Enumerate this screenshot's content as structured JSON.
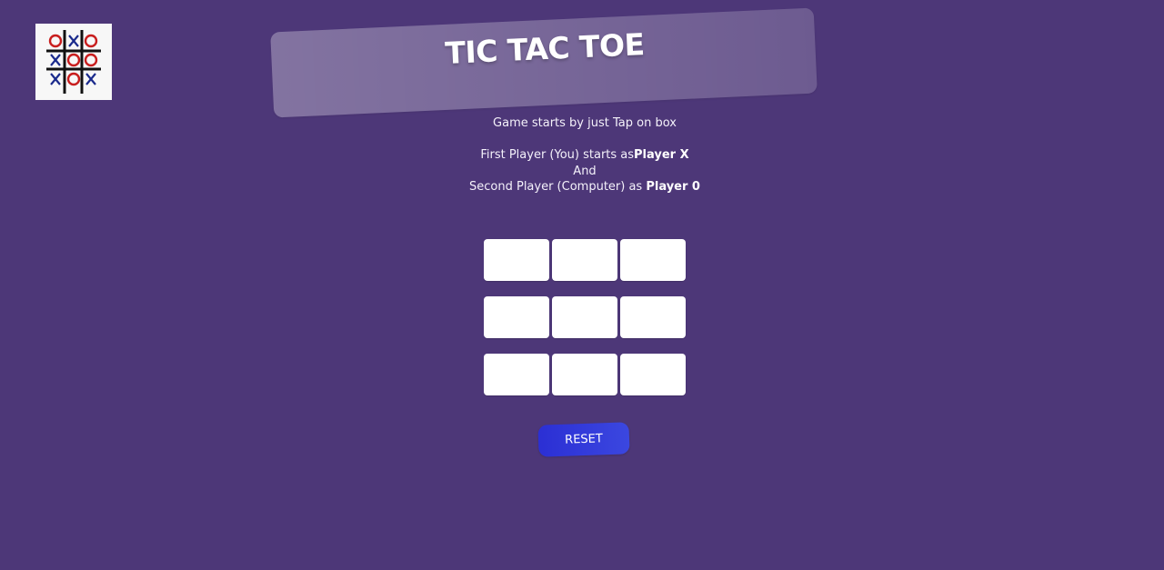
{
  "header": {
    "title": "TIC TAC TOE",
    "logo_icon": "tic-tac-toe-logo-icon",
    "logo_cells": [
      "O",
      "X",
      "O",
      "X",
      "O",
      "O",
      "X",
      "O",
      "X"
    ]
  },
  "instructions": {
    "line1": "Game starts by just Tap on box",
    "line2_prefix": "First Player (You) starts as",
    "line2_bold": "Player X",
    "line3": "And",
    "line4_prefix": "Second Player (Computer) as ",
    "line4_bold": "Player 0"
  },
  "board": {
    "cells": [
      "",
      "",
      "",
      "",
      "",
      "",
      "",
      "",
      ""
    ]
  },
  "controls": {
    "reset_label": "RESET"
  },
  "colors": {
    "background": "#4d3778",
    "reset_button": "#2b2fd4",
    "logo_x": "#1a2a8c",
    "logo_o": "#c81e1e"
  }
}
